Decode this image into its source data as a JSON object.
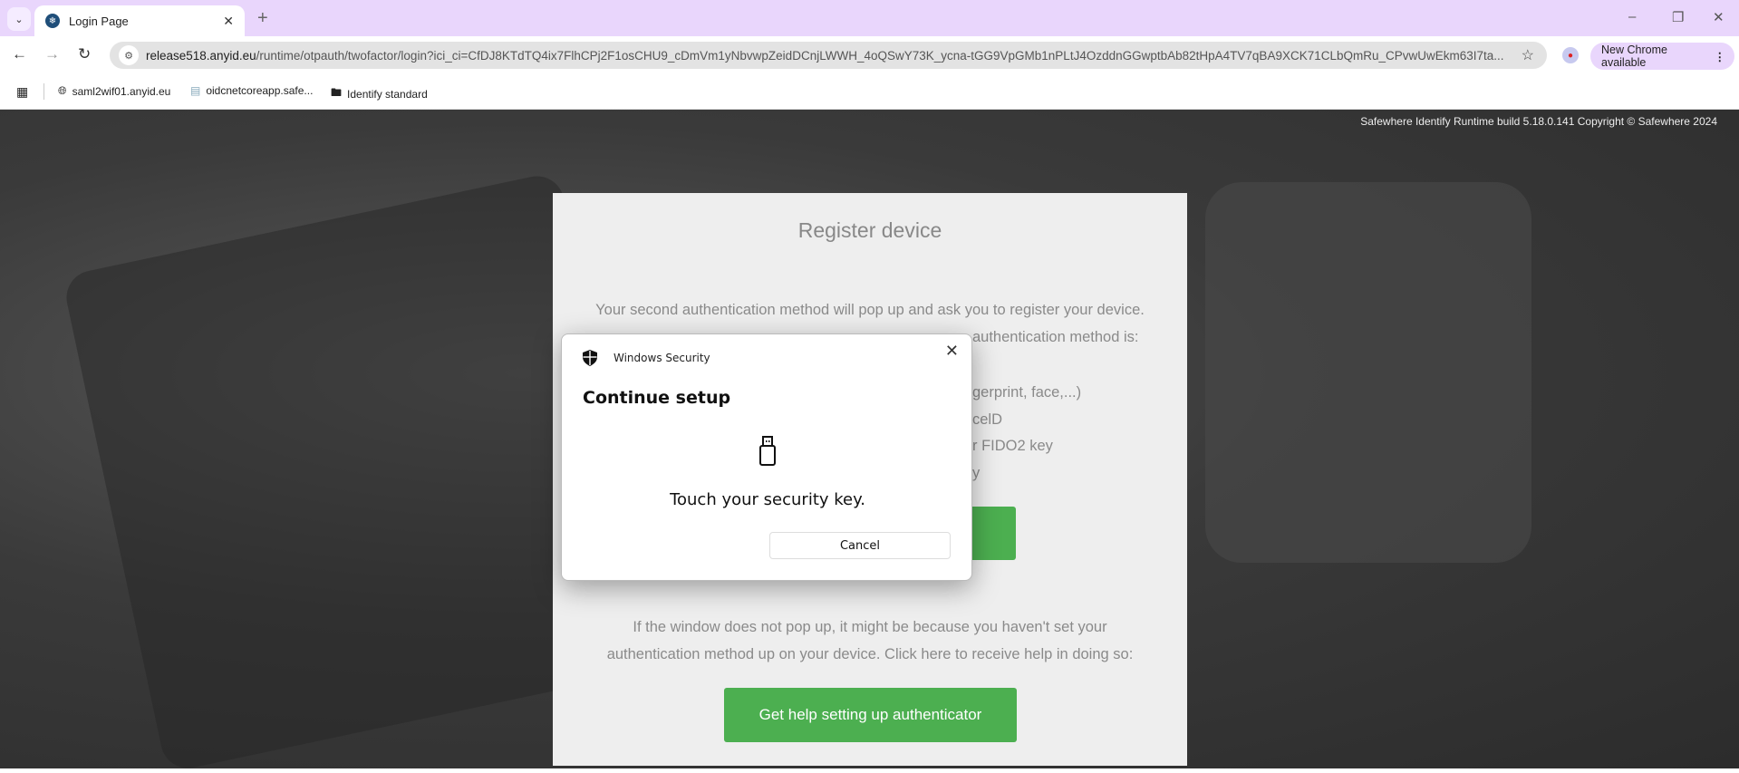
{
  "browser": {
    "tab_title": "Login Page",
    "url_host": "release518.anyid.eu",
    "url_path": "/runtime/otpauth/twofactor/login?ici_ci=CfDJ8KTdTQ4ix7FlhCPj2F1osCHU9_cDmVm1yNbvwpZeidDCnjLWWH_4oQSwY73K_ycna-tGG9VpGMb1nPLtJ4OzddnGGwptbAb82tHpA4TV7qBA9XCK71CLbQmRu_CPvwUwEkm63I7ta...",
    "update_label": "New Chrome available",
    "bookmarks": [
      {
        "label": "saml2wif01.anyid.eu",
        "icon": "globe-icon"
      },
      {
        "label": "oidcnetcoreapp.safe...",
        "icon": "page-icon"
      },
      {
        "label": "Identify standard",
        "icon": "folder-icon"
      }
    ]
  },
  "page": {
    "copyright": "Safewhere Identify Runtime build 5.18.0.141 Copyright © Safewhere 2024",
    "title": "Register device",
    "intro_line1": "Your second authentication method will pop up and ask you to register your device.",
    "intro_line2_visible": "authentication method is:",
    "list_visible": [
      "gerprint, face,...)",
      "celD",
      "r FIDO2 key",
      "y"
    ],
    "help_line1": "If the window does not pop up, it might be because you haven't set your",
    "help_line2": "authentication method up on your device. Click here to receive help in doing so:",
    "help_button": "Get help setting up authenticator",
    "accent": "#4caf50"
  },
  "dialog": {
    "app": "Windows Security",
    "heading": "Continue setup",
    "message": "Touch your security key.",
    "cancel": "Cancel"
  }
}
